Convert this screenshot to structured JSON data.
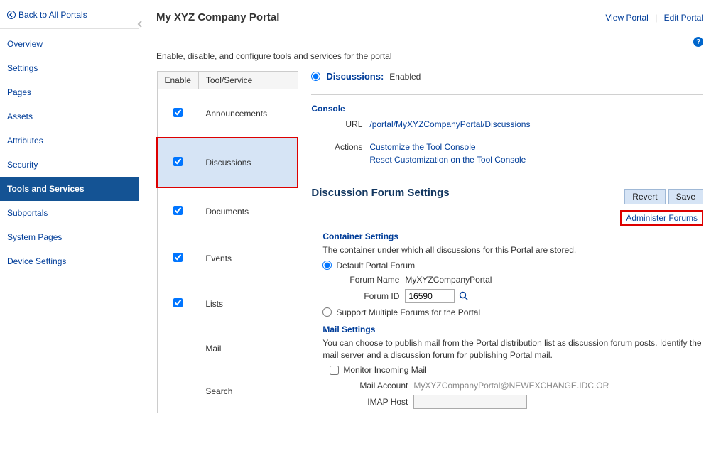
{
  "sidebar": {
    "back_label": "Back to All Portals",
    "items": [
      {
        "label": "Overview"
      },
      {
        "label": "Settings"
      },
      {
        "label": "Pages"
      },
      {
        "label": "Assets"
      },
      {
        "label": "Attributes"
      },
      {
        "label": "Security"
      },
      {
        "label": "Tools and Services"
      },
      {
        "label": "Subportals"
      },
      {
        "label": "System Pages"
      },
      {
        "label": "Device Settings"
      }
    ]
  },
  "header": {
    "title": "My XYZ Company Portal",
    "view_label": "View Portal",
    "edit_label": "Edit Portal"
  },
  "subtitle": "Enable, disable, and configure tools and services for the portal",
  "tools_table": {
    "col_enable": "Enable",
    "col_tool": "Tool/Service",
    "rows": [
      {
        "label": "Announcements",
        "checked": true
      },
      {
        "label": "Discussions",
        "checked": true
      },
      {
        "label": "Documents",
        "checked": true
      },
      {
        "label": "Events",
        "checked": true
      },
      {
        "label": "Lists",
        "checked": true
      },
      {
        "label": "Mail",
        "checked": false
      },
      {
        "label": "Search",
        "checked": false
      }
    ]
  },
  "detail": {
    "status_tool": "Discussions:",
    "status_state": "Enabled",
    "console_heading": "Console",
    "url_label": "URL",
    "url_value": "/portal/MyXYZCompanyPortal/Discussions",
    "actions_label": "Actions",
    "action_customize": "Customize the Tool Console",
    "action_reset": "Reset Customization on the Tool Console",
    "settings_heading": "Discussion Forum Settings",
    "revert_btn": "Revert",
    "save_btn": "Save",
    "admin_link": "Administer Forums",
    "container_heading": "Container Settings",
    "container_desc": "The container under which all discussions for this Portal are stored.",
    "radio_default": "Default Portal Forum",
    "forum_name_label": "Forum Name",
    "forum_name_value": "MyXYZCompanyPortal",
    "forum_id_label": "Forum ID",
    "forum_id_value": "16590",
    "radio_multiple": "Support Multiple Forums for the Portal",
    "mail_heading": "Mail Settings",
    "mail_desc": "You can choose to publish mail from the Portal distribution list as discussion forum posts. Identify the mail server and a discussion forum for publishing Portal mail.",
    "monitor_label": "Monitor Incoming Mail",
    "mail_account_label": "Mail Account",
    "mail_account_value": "MyXYZCompanyPortal@NEWEXCHANGE.IDC.OR",
    "imap_host_label": "IMAP Host"
  }
}
